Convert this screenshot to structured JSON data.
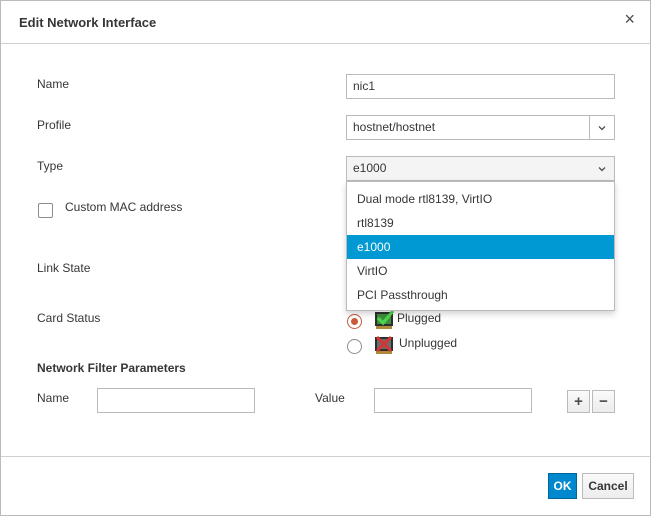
{
  "dialog": {
    "title": "Edit Network Interface",
    "close_glyph": "×"
  },
  "form": {
    "name_label": "Name",
    "name_value": "nic1",
    "profile_label": "Profile",
    "profile_value": "hostnet/hostnet",
    "type_label": "Type",
    "type_value": "e1000",
    "custom_mac_label": "Custom MAC address",
    "custom_mac_checked": false,
    "link_state_label": "Link State",
    "card_status_label": "Card Status",
    "card_status_options": [
      {
        "label": "Plugged",
        "checked": true,
        "icon": "nic-plugged-icon"
      },
      {
        "label": "Unplugged",
        "checked": false,
        "icon": "nic-unplugged-icon"
      }
    ]
  },
  "type_dropdown": {
    "options": [
      {
        "label": "Dual mode rtl8139, VirtIO",
        "selected": false
      },
      {
        "label": "rtl8139",
        "selected": false
      },
      {
        "label": "e1000",
        "selected": true
      },
      {
        "label": "VirtIO",
        "selected": false
      },
      {
        "label": "PCI Passthrough",
        "selected": false
      }
    ]
  },
  "filter": {
    "section_title": "Network Filter Parameters",
    "name_label": "Name",
    "name_value": "",
    "value_label": "Value",
    "value_value": "",
    "add_glyph": "+",
    "remove_glyph": "−"
  },
  "footer": {
    "ok_label": "OK",
    "cancel_label": "Cancel"
  },
  "colors": {
    "primary": "#0088ce",
    "selected_option": "#0099d3",
    "radio_checked": "#c75b3a"
  }
}
